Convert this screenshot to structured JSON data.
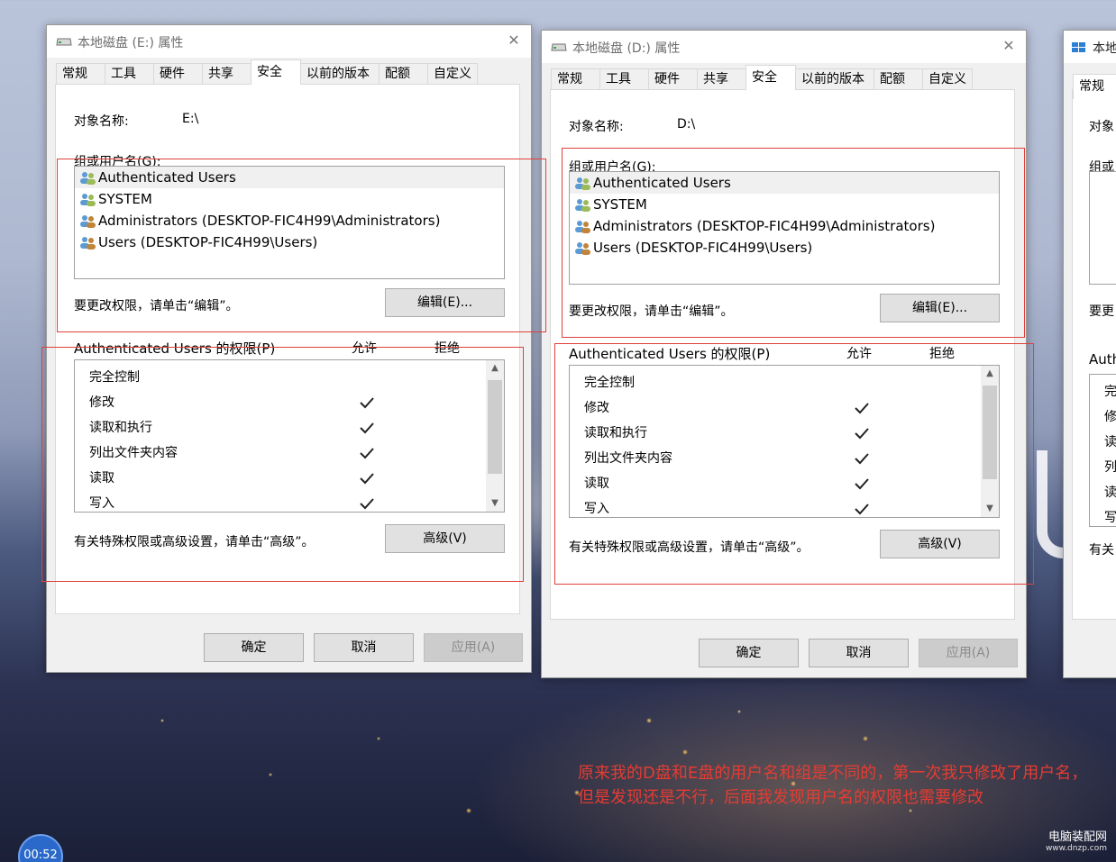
{
  "windows": [
    {
      "title": "本地磁盘 (E:) 属性",
      "tabs": [
        "常规",
        "工具",
        "硬件",
        "共享",
        "安全",
        "以前的版本",
        "配额",
        "自定义"
      ],
      "active_tab": "安全",
      "object_label": "对象名称:",
      "object_value": "E:\\",
      "group_label": "组或用户名(G):",
      "users": [
        "Authenticated Users",
        "SYSTEM",
        "Administrators (DESKTOP-FIC4H99\\Administrators)",
        "Users (DESKTOP-FIC4H99\\Users)"
      ],
      "edit_hint": "要更改权限，请单击“编辑”。",
      "edit_button": "编辑(E)...",
      "perm_label": "Authenticated Users 的权限(P)",
      "allow_col": "允许",
      "deny_col": "拒绝",
      "permissions": [
        {
          "name": "完全控制",
          "allow": false
        },
        {
          "name": "修改",
          "allow": true
        },
        {
          "name": "读取和执行",
          "allow": true
        },
        {
          "name": "列出文件夹内容",
          "allow": true
        },
        {
          "name": "读取",
          "allow": true
        },
        {
          "name": "写入",
          "allow": true
        }
      ],
      "advanced_hint": "有关特殊权限或高级设置，请单击“高级”。",
      "advanced_button": "高级(V)",
      "ok_button": "确定",
      "cancel_button": "取消",
      "apply_button": "应用(A)"
    },
    {
      "title": "本地磁盘 (D:) 属性",
      "tabs": [
        "常规",
        "工具",
        "硬件",
        "共享",
        "安全",
        "以前的版本",
        "配额",
        "自定义"
      ],
      "active_tab": "安全",
      "object_label": "对象名称:",
      "object_value": "D:\\",
      "group_label": "组或用户名(G):",
      "users": [
        "Authenticated Users",
        "SYSTEM",
        "Administrators (DESKTOP-FIC4H99\\Administrators)",
        "Users (DESKTOP-FIC4H99\\Users)"
      ],
      "edit_hint": "要更改权限，请单击“编辑”。",
      "edit_button": "编辑(E)...",
      "perm_label": "Authenticated Users 的权限(P)",
      "allow_col": "允许",
      "deny_col": "拒绝",
      "permissions": [
        {
          "name": "完全控制",
          "allow": false
        },
        {
          "name": "修改",
          "allow": true
        },
        {
          "name": "读取和执行",
          "allow": true
        },
        {
          "name": "列出文件夹内容",
          "allow": true
        },
        {
          "name": "读取",
          "allow": true
        },
        {
          "name": "写入",
          "allow": true
        }
      ],
      "advanced_hint": "有关特殊权限或高级设置，请单击“高级”。",
      "advanced_button": "高级(V)",
      "ok_button": "确定",
      "cancel_button": "取消",
      "apply_button": "应用(A)"
    }
  ],
  "third_window": {
    "title": "本地",
    "tab": "常规",
    "lines": [
      "对象",
      "组或",
      "要更",
      "Auth",
      "有关"
    ],
    "perm_rows": [
      "完",
      "修",
      "读",
      "列",
      "读",
      "写"
    ]
  },
  "annotation": "原来我的D盘和E盘的用户名和组是不同的，第一次我只修改了用户名，但是发现还是不行，后面我发现用户名的权限也需要修改",
  "watermark": {
    "main": "电脑装配网",
    "sub": "www.dnzp.com"
  },
  "clock": "00:52",
  "colors": {
    "annotation": "#e53c32",
    "button": "#e1e1e1",
    "selected_row": "#f0f0f0"
  }
}
